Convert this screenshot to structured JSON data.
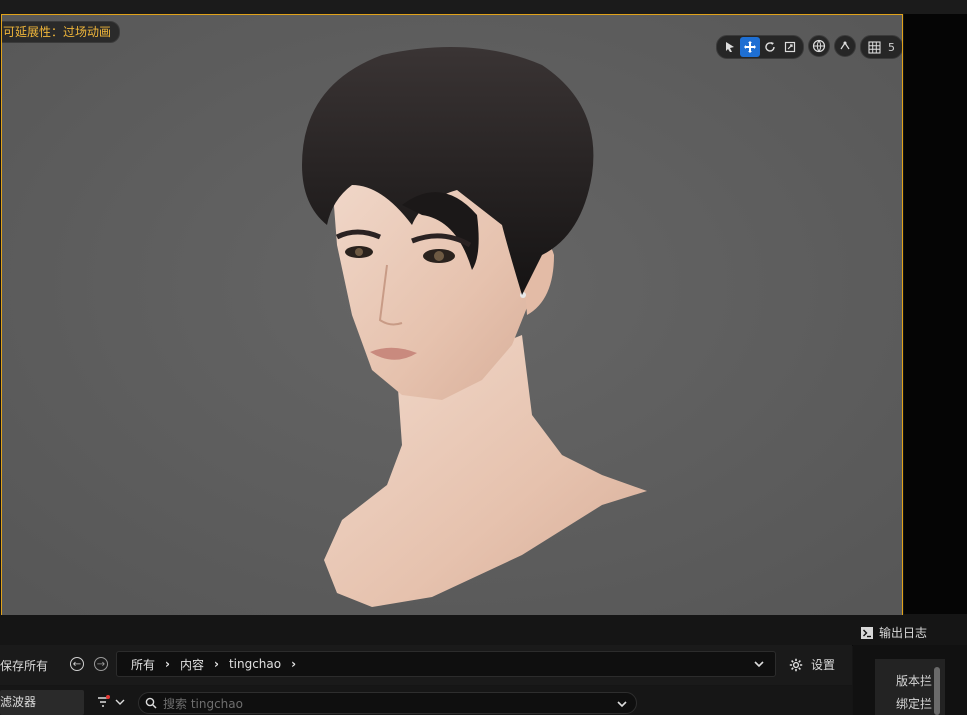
{
  "viewport": {
    "badge": "可延展性：过场动画",
    "grid_size": "5",
    "angle_partial": "1"
  },
  "panels": {
    "output_log": "输出日志",
    "save_all": "保存所有",
    "filter": "滤波器",
    "settings": "设置",
    "search_placeholder": "搜索 tingchao",
    "breadcrumb": [
      "所有",
      "内容",
      "tingchao"
    ],
    "right_items": [
      "版本拦",
      "绑定拦"
    ]
  },
  "colors": {
    "viewport_border": "#e0a21a",
    "badge_text": "#f0b63a",
    "active_tool": "#1e6fd3"
  }
}
